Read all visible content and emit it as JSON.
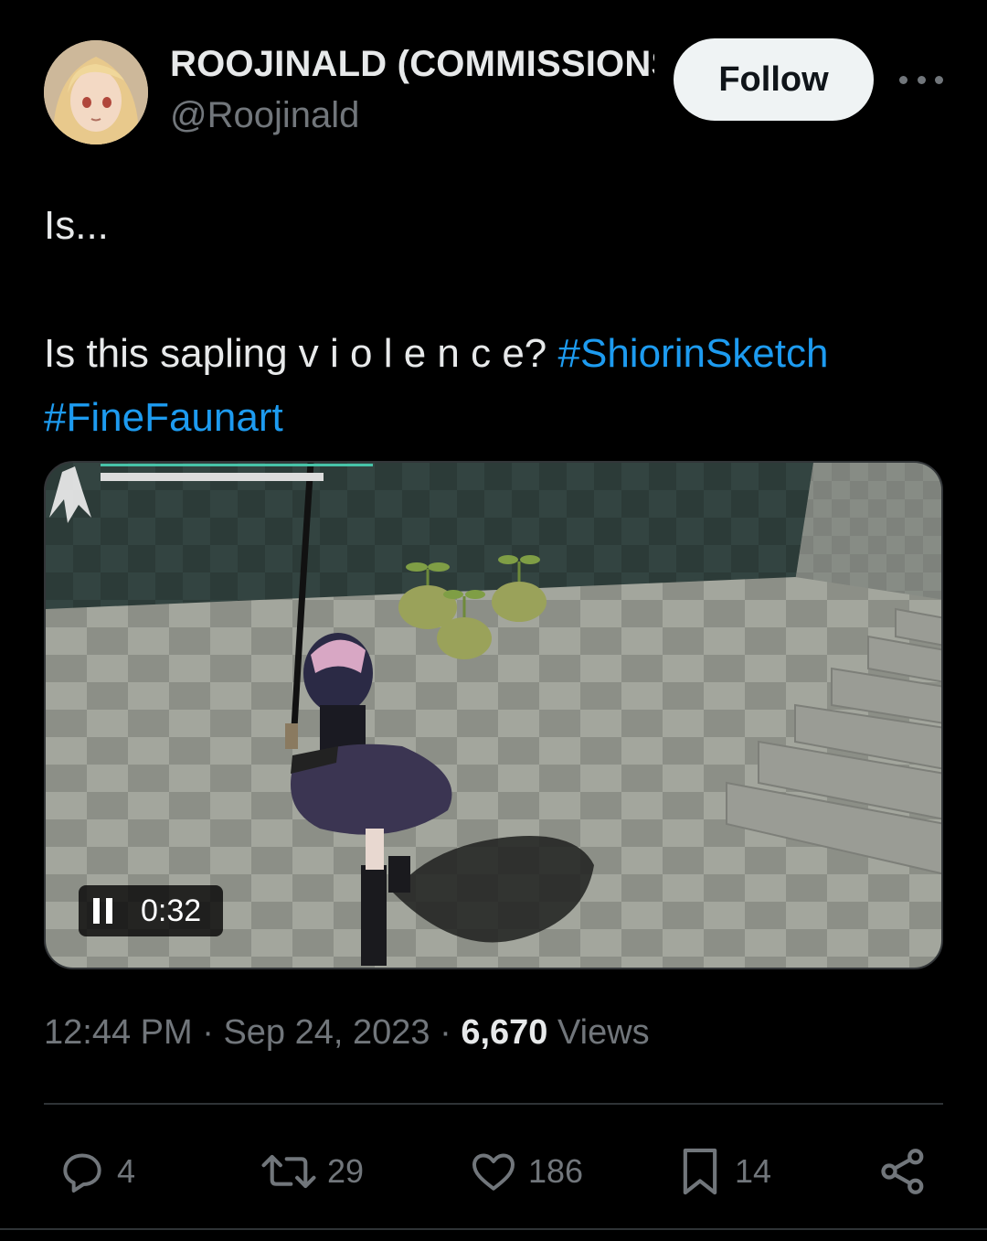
{
  "author": {
    "display_name": "ROOJINALD (COMMISSIONS OPEN)",
    "handle": "@Roojinald",
    "follow_label": "Follow"
  },
  "tweet": {
    "line1": "Is...",
    "line2_text": "Is this sapling v i o l e n c e? ",
    "hashtags": [
      "#ShiorinSketch",
      "#FineFaunart"
    ]
  },
  "media": {
    "elapsed": "0:32",
    "progress": 0.37
  },
  "meta": {
    "time": "12:44 PM",
    "separator": "·",
    "date": "Sep 24, 2023",
    "views_count": "6,670",
    "views_label": "Views"
  },
  "actions": {
    "replies": "4",
    "reposts": "29",
    "likes": "186",
    "bookmarks": "14"
  },
  "colors": {
    "accent": "#1d9bf0",
    "secondary_text": "#71767b",
    "primary_text": "#e7e9ea",
    "background": "#000000"
  },
  "icons": [
    "more-icon",
    "pause-icon",
    "reply-icon",
    "repost-icon",
    "like-icon",
    "bookmark-icon",
    "share-icon"
  ]
}
